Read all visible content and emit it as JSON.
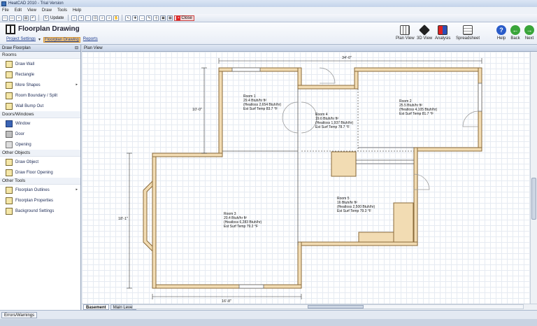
{
  "window": {
    "title": "HeatCAD 2010 - Trial Version"
  },
  "menu": [
    "File",
    "Edit",
    "View",
    "Draw",
    "Tools",
    "Help"
  ],
  "toolbar": {
    "update_label": "Update",
    "close_label": "Close"
  },
  "ribbon": {
    "title": "Floorplan Drawing",
    "links": [
      {
        "label": "Project Settings",
        "active": false
      },
      {
        "label": "Floorplan Drawing",
        "active": true
      },
      {
        "label": "Reports",
        "active": false
      }
    ],
    "buttons": [
      "Plan View",
      "3D View",
      "Analysis",
      "Spreadsheet",
      "Help",
      "Back",
      "Next"
    ]
  },
  "sidebar": {
    "title": "Draw Floorplan",
    "groups": [
      {
        "label": "Rooms",
        "items": [
          "Draw Wall",
          "Rectangle",
          "More Shapes",
          "Room Boundary / Split",
          "Wall Bump Out"
        ]
      },
      {
        "label": "Doors/Windows",
        "items": [
          "Window",
          "Door",
          "Opening"
        ]
      },
      {
        "label": "Other Objects",
        "items": [
          "Draw Object",
          "Draw Floor Opening"
        ]
      },
      {
        "label": "Other Tools",
        "items": [
          "Floorplan Outlines",
          "Floorplan Properties",
          "Background Settings"
        ]
      }
    ]
  },
  "canvas": {
    "title": "Plan View",
    "dimensions": {
      "top": "34'-0\"",
      "left_upper": "10'-0\"",
      "left_lower": "18'-1\"",
      "bottom": "16'-8\""
    },
    "rooms": [
      {
        "name": "Room 1",
        "lines": [
          "29.4 Btuh/hr ft²",
          "(Heatloss 2,654 Btuh/hr)",
          "Est Surf Temp 83.7 °F"
        ]
      },
      {
        "name": "Room 2",
        "lines": [
          "25.5 Btuh/hr ft²",
          "(Heatloss 4,105 Btuh/hr)",
          "Est Surf Temp 81.7 °F"
        ]
      },
      {
        "name": "Room 3",
        "lines": [
          "20.4 Btuh/hr ft²",
          "(Heatloss 6,283 Btuh/hr)",
          "Est Surf Temp 79.2 °F"
        ]
      },
      {
        "name": "Room 4",
        "lines": [
          "19.6 Btuh/hr ft²",
          "(Heatloss 1,937 Btuh/hr)",
          "Est Surf Temp 78.7 °F"
        ]
      },
      {
        "name": "Room 5",
        "lines": [
          "16 Btuh/hr ft²",
          "(Heatloss 2,500 Btuh/hr)",
          "Est Surf Temp 79.3 °F"
        ]
      }
    ]
  },
  "tabs": [
    "Basement",
    "Main Level"
  ],
  "status": {
    "errors_tab": "Errors/Warnings"
  }
}
